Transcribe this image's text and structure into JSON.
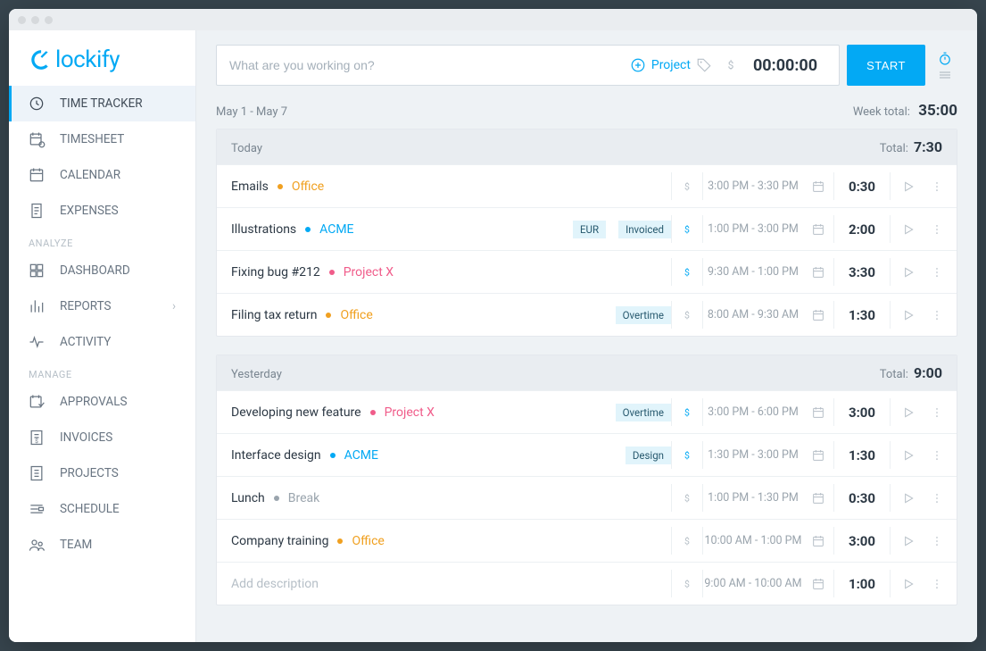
{
  "brand": "lockify",
  "sidebar": {
    "sections": [
      {
        "heading": null,
        "items": [
          {
            "label": "TIME TRACKER",
            "icon": "clock-icon",
            "active": true
          },
          {
            "label": "TIMESHEET",
            "icon": "timesheet-icon"
          },
          {
            "label": "CALENDAR",
            "icon": "calendar-icon"
          },
          {
            "label": "EXPENSES",
            "icon": "receipt-icon"
          }
        ]
      },
      {
        "heading": "ANALYZE",
        "items": [
          {
            "label": "DASHBOARD",
            "icon": "grid-icon"
          },
          {
            "label": "REPORTS",
            "icon": "bars-icon",
            "chevron": true
          },
          {
            "label": "ACTIVITY",
            "icon": "pulse-icon"
          }
        ]
      },
      {
        "heading": "MANAGE",
        "items": [
          {
            "label": "APPROVALS",
            "icon": "approve-icon"
          },
          {
            "label": "INVOICES",
            "icon": "invoice-icon"
          },
          {
            "label": "PROJECTS",
            "icon": "doc-icon"
          },
          {
            "label": "SCHEDULE",
            "icon": "schedule-icon"
          },
          {
            "label": "TEAM",
            "icon": "team-icon"
          }
        ]
      }
    ]
  },
  "tracker": {
    "placeholder": "What are you working on?",
    "project_label": "Project",
    "timer": "00:00:00",
    "start_label": "START"
  },
  "week": {
    "range": "May 1 - May 7",
    "total_label": "Week total:",
    "total": "35:00"
  },
  "days": [
    {
      "label": "Today",
      "total_label": "Total:",
      "total": "7:30",
      "entries": [
        {
          "desc": "Emails",
          "project": "Office",
          "color": "#f0a020",
          "tags": [],
          "billable": false,
          "range": "3:00 PM - 3:30 PM",
          "duration": "0:30"
        },
        {
          "desc": "Illustrations",
          "project": "ACME",
          "color": "#03a9f4",
          "tags": [
            "EUR",
            "Invoiced"
          ],
          "billable": true,
          "range": "1:00 PM - 3:00 PM",
          "duration": "2:00"
        },
        {
          "desc": "Fixing bug #212",
          "project": "Project X",
          "color": "#f05c8a",
          "tags": [],
          "billable": true,
          "range": "9:30 AM - 1:00 PM",
          "duration": "3:30"
        },
        {
          "desc": "Filing tax return",
          "project": "Office",
          "color": "#f0a020",
          "tags": [
            "Overtime"
          ],
          "billable": false,
          "range": "8:00 AM - 9:30 AM",
          "duration": "1:30"
        }
      ]
    },
    {
      "label": "Yesterday",
      "total_label": "Total:",
      "total": "9:00",
      "entries": [
        {
          "desc": "Developing new feature",
          "project": "Project X",
          "color": "#f05c8a",
          "tags": [
            "Overtime"
          ],
          "billable": true,
          "range": "3:00 PM - 6:00 PM",
          "duration": "3:00"
        },
        {
          "desc": "Interface design",
          "project": "ACME",
          "color": "#03a9f4",
          "tags": [
            "Design"
          ],
          "billable": true,
          "range": "1:30 PM - 3:00 PM",
          "duration": "1:30"
        },
        {
          "desc": "Lunch",
          "project": "Break",
          "color": "#9aa4ad",
          "tags": [],
          "billable": false,
          "range": "1:00 PM - 1:30 PM",
          "duration": "0:30"
        },
        {
          "desc": "Company training",
          "project": "Office",
          "color": "#f0a020",
          "tags": [],
          "billable": false,
          "range": "10:00 AM - 1:00 PM",
          "duration": "3:00"
        },
        {
          "desc": "",
          "placeholder": "Add description",
          "project": null,
          "color": null,
          "tags": [],
          "billable": false,
          "range": "9:00 AM - 10:00 AM",
          "duration": "1:00"
        }
      ]
    }
  ]
}
